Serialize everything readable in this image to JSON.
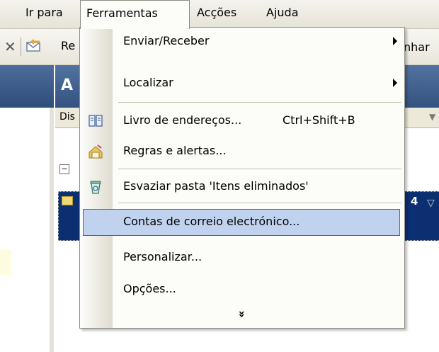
{
  "menubar": {
    "items": [
      {
        "label": "Ir para"
      },
      {
        "label": "Ferramentas"
      },
      {
        "label": "Acções"
      },
      {
        "label": "Ajuda"
      }
    ]
  },
  "toolbar": {
    "reply_label": "Re",
    "right_label": "nhar"
  },
  "main": {
    "title": "A",
    "column_label": "Dis",
    "column_right": "▼",
    "row_number": "4",
    "row_flag": "▽"
  },
  "dropdown": {
    "items": [
      {
        "label": "Enviar/Receber",
        "submenu": true
      },
      {
        "label": "Localizar",
        "submenu": true
      },
      {
        "label": "Livro de endereços...",
        "shortcut": "Ctrl+Shift+B",
        "icon": "address-book-icon"
      },
      {
        "label": "Regras e alertas...",
        "icon": "rules-alerts-icon"
      },
      {
        "label": "Esvaziar pasta 'Itens eliminados'",
        "icon": "empty-trash-icon"
      },
      {
        "label": "Contas de correio electrónico...",
        "highlighted": true
      },
      {
        "label": "Personalizar..."
      },
      {
        "label": "Opções..."
      }
    ],
    "expand": "»"
  },
  "colors": {
    "menu_highlight": "#c1d2ee",
    "menu_highlight_border": "#316ac5",
    "selected_row": "#0c2f72",
    "pane_header": "#3d5d8c"
  }
}
